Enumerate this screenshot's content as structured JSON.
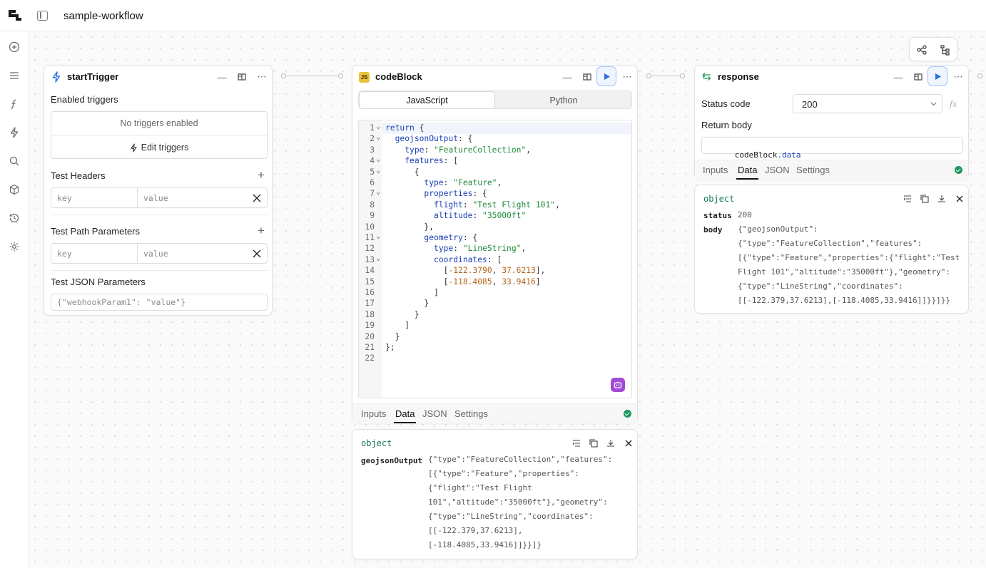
{
  "workflow": {
    "title": "sample-workflow"
  },
  "start_trigger": {
    "title": "startTrigger",
    "enabled_triggers_label": "Enabled triggers",
    "no_triggers_text": "No triggers enabled",
    "edit_triggers_label": "Edit triggers",
    "test_headers_label": "Test Headers",
    "test_path_params_label": "Test Path Parameters",
    "test_json_params_label": "Test JSON Parameters",
    "key_placeholder": "key",
    "value_placeholder": "value",
    "json_params_placeholder": "{\"webhookParam1\": \"value\"}"
  },
  "code_block": {
    "title": "codeBlock",
    "badge": "JS",
    "lang_tabs": [
      "JavaScript",
      "Python"
    ],
    "active_lang": "JavaScript",
    "tabs": [
      "Inputs",
      "Data",
      "JSON",
      "Settings"
    ],
    "active_tab": "Data",
    "output": {
      "type_label": "object",
      "key": "geojsonOutput",
      "value_lines": [
        "{\"type\":\"FeatureCollection\",\"features\":",
        "[{\"type\":\"Feature\",\"properties\":",
        "{\"flight\":\"Test Flight",
        "101\",\"altitude\":\"35000ft\"},\"geometry\":",
        "{\"type\":\"LineString\",\"coordinates\":",
        "[[-122.379,37.6213],",
        "[-118.4085,33.9416]]}}]}"
      ]
    }
  },
  "response": {
    "title": "response",
    "status_code_label": "Status code",
    "status_code_value": "200",
    "return_body_label": "Return body",
    "return_body_prefix": "codeBlock",
    "return_body_suffix": ".data",
    "fx_label": "fx",
    "tabs": [
      "Inputs",
      "Data",
      "JSON",
      "Settings"
    ],
    "active_tab": "Data",
    "output": {
      "type_label": "object",
      "status_key": "status",
      "status_value": "200",
      "body_key": "body",
      "body_lines": [
        "{\"geojsonOutput\":",
        "{\"type\":\"FeatureCollection\",\"features\":",
        "[{\"type\":\"Feature\",\"properties\":{\"flight\":\"Test",
        "Flight 101\",\"altitude\":\"35000ft\"},\"geometry\":",
        "{\"type\":\"LineString\",\"coordinates\":",
        "[[-122.379,37.6213],[-118.4085,33.9416]]}}]}}"
      ]
    }
  },
  "colors": {
    "accent": "#2f6fe0",
    "success": "#1a9a5a",
    "object_label": "#1a7a5a",
    "ai_button": "#a24bd6"
  }
}
